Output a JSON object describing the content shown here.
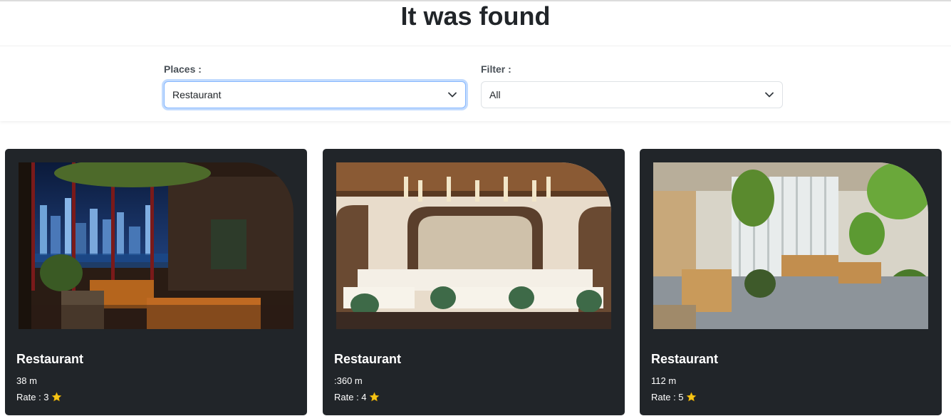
{
  "page": {
    "title": "It was found"
  },
  "filters": {
    "places": {
      "label": "Places :",
      "value": "Restaurant"
    },
    "filter": {
      "label": "Filter :",
      "value": "All"
    }
  },
  "icons": {
    "dropdown": "chevron-down-icon",
    "rating": "star-icon"
  },
  "colors": {
    "card_bg": "#212529",
    "focus_border": "#86b7fe",
    "star": "#f5c518"
  },
  "cards": [
    {
      "title": "Restaurant",
      "distance": "38 m",
      "rate_label": "Rate : 3",
      "image": "night city-view restaurant with hanging plants"
    },
    {
      "title": "Restaurant",
      "distance": ":360 m",
      "rate_label": "Rate : 4",
      "image": "elegant dining room with pendant lights and green chairs"
    },
    {
      "title": "Restaurant",
      "distance": "112 m",
      "rate_label": "Rate : 5",
      "image": "garden restaurant with plants and wooden chairs"
    }
  ]
}
